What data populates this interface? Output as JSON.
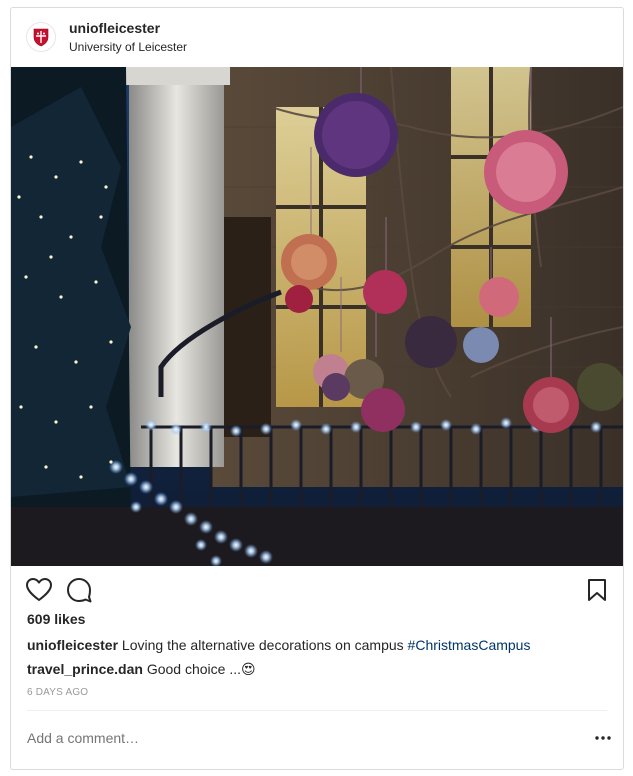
{
  "post": {
    "username": "uniofleicester",
    "location": "University of Leicester",
    "likes": "609 likes",
    "caption_user": "uniofleicester",
    "caption_text": " Loving the alternative decorations on campus ",
    "caption_hashtag": "#ChristmasCampus",
    "comment_user": "travel_prince.dan",
    "comment_text": " Good choice ...",
    "comment_emoji": "😍",
    "time": "6 DAYS AGO",
    "add_comment_placeholder": "Add a comment…"
  },
  "icons": {
    "like": "heart-icon",
    "comment": "comment-bubble-icon",
    "save": "bookmark-icon",
    "more": "more-options-icon",
    "avatar": "university-shield-logo"
  },
  "colors": {
    "text": "#262626",
    "muted": "#999999",
    "hashtag": "#003569",
    "border": "#dbdbdb"
  }
}
